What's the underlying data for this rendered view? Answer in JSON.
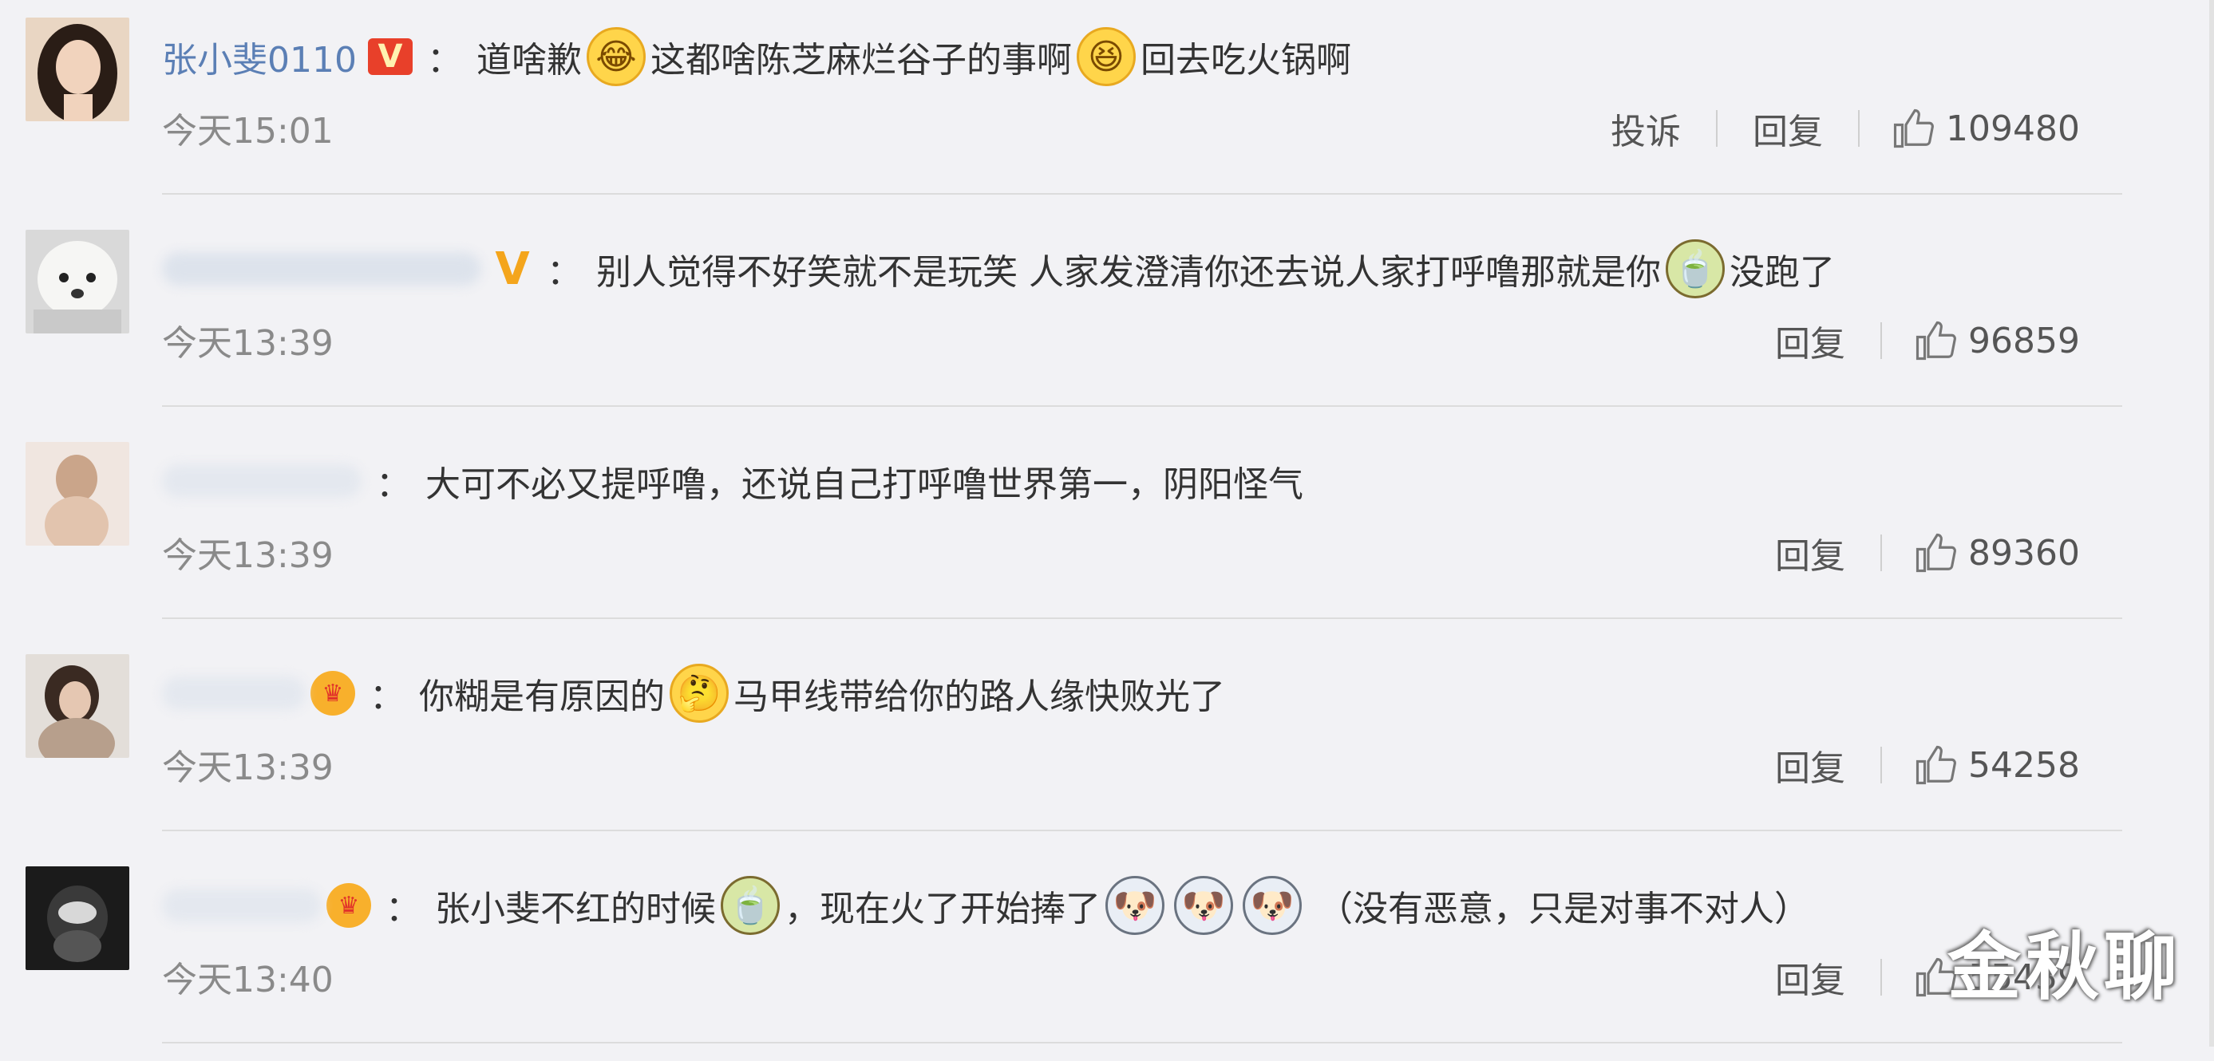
{
  "comments": [
    {
      "username": "张小斐0110",
      "text": [
        "道啥歉",
        "这都啥陈芝麻烂谷子的事啊",
        "回去吃火锅啊"
      ],
      "time": "今天15:01",
      "report_label": "投诉",
      "reply_label": "回复",
      "likes": "109480"
    },
    {
      "text": [
        "别人觉得不好笑就不是玩笑 人家发澄清你还去说人家打呼噜那就是你",
        "没跑了"
      ],
      "time": "今天13:39",
      "reply_label": "回复",
      "likes": "96859"
    },
    {
      "text": [
        "大可不必又提呼噜，还说自己打呼噜世界第一，阴阳怪气"
      ],
      "time": "今天13:39",
      "reply_label": "回复",
      "likes": "89360"
    },
    {
      "text": [
        "你糊是有原因的",
        "马甲线带给你的路人缘快败光了"
      ],
      "time": "今天13:39",
      "reply_label": "回复",
      "likes": "54258"
    },
    {
      "text": [
        "张小斐不红的时候",
        "，现在火了开始捧了",
        "（没有恶意，只是对事不对人）"
      ],
      "time": "今天13:40",
      "reply_label": "回复",
      "likes": "55439"
    }
  ],
  "colon": "：",
  "watermark": "金秋聊",
  "colors": {
    "background": "#f2f2f5",
    "username": "#5b7fb5",
    "badge_red": "#e8402a",
    "badge_gold": "#f4a51c",
    "time": "#8a8a8a"
  },
  "icons": [
    "thumbs-up-icon",
    "verified-v-icon",
    "crown-icon",
    "cry-laugh-emoji",
    "laugh-emoji",
    "tea-emoji",
    "thinking-emoji",
    "dog-emoji"
  ]
}
